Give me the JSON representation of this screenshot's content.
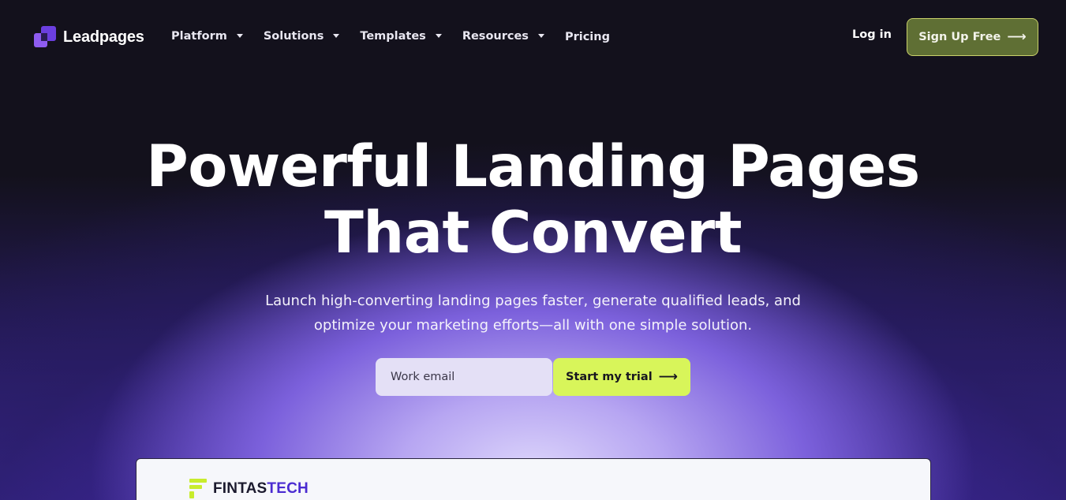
{
  "nav": {
    "logo_text": "Leadpages",
    "items": [
      {
        "label": "Platform",
        "has_dropdown": true
      },
      {
        "label": "Solutions",
        "has_dropdown": true
      },
      {
        "label": "Templates",
        "has_dropdown": true
      },
      {
        "label": "Resources",
        "has_dropdown": true
      },
      {
        "label": "Pricing",
        "has_dropdown": false
      }
    ],
    "login_label": "Log in",
    "signup_label": "Sign Up Free",
    "signup_icon": "arrow-right-icon"
  },
  "hero": {
    "title_line1": "Powerful Landing Pages",
    "title_line2": "That Convert",
    "subtitle_line1": "Launch high-converting landing pages faster, generate qualified leads, and",
    "subtitle_line2": "optimize your marketing efforts—all with one simple solution.",
    "email_placeholder": "Work email",
    "email_value": "",
    "cta_label": "Start my trial",
    "cta_icon": "arrow-right-icon"
  },
  "preview": {
    "brand_part1": "FINTAS",
    "brand_part2": "TECH"
  },
  "colors": {
    "background": "#13111c",
    "accent_lime": "#d8f55a",
    "signup_green": "#5f6f34",
    "brand_purple": "#6b3fe0",
    "fintas_lime": "#c8ec2d",
    "fintas_purple": "#4a2bd1"
  }
}
